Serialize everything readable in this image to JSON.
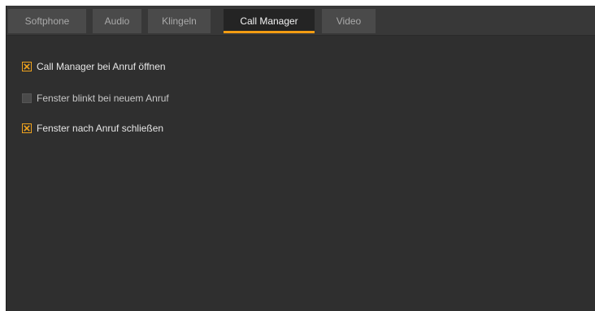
{
  "tabs": [
    {
      "label": "Softphone",
      "active": false
    },
    {
      "label": "Audio",
      "active": false
    },
    {
      "label": "Klingeln",
      "active": false
    },
    {
      "label": "Call Manager",
      "active": true
    },
    {
      "label": "Video",
      "active": false
    }
  ],
  "options": [
    {
      "label": "Call Manager bei Anruf öffnen",
      "checked": true
    },
    {
      "label": "Fenster blinkt bei neuem Anruf",
      "checked": false
    },
    {
      "label": "Fenster nach Anruf schließen",
      "checked": true
    }
  ],
  "colors": {
    "accent": "#f39c12",
    "background": "#2f2f2f",
    "tab_inactive": "#4a4a4a",
    "tab_active": "#242424"
  }
}
